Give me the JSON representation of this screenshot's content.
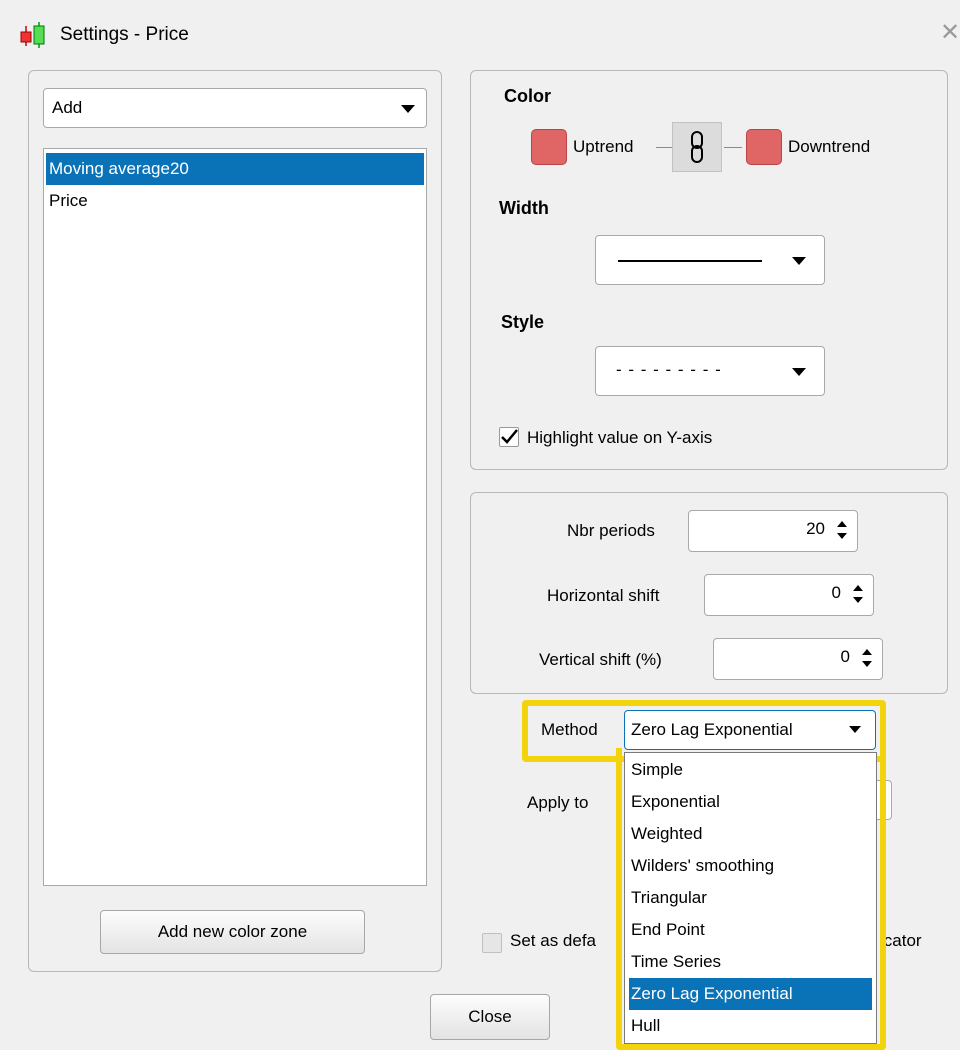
{
  "window": {
    "title": "Settings - Price",
    "app_icon": "candlestick-chart-icon",
    "close_icon": "close-icon"
  },
  "left": {
    "add_select": {
      "value": "Add"
    },
    "layers": [
      {
        "label": "Moving average20",
        "selected": true
      },
      {
        "label": "Price",
        "selected": false
      }
    ],
    "add_zone_button": "Add new color zone"
  },
  "appearance": {
    "color_label": "Color",
    "uptrend_label": "Uptrend",
    "downtrend_label": "Downtrend",
    "uptrend_color": "#e06666",
    "downtrend_color": "#e06666",
    "link_icon": "chain-link-icon",
    "width_label": "Width",
    "width_value": "solid-line",
    "style_label": "Style",
    "style_value": "- - - - - - - - -",
    "highlight_label": "Highlight value on Y-axis",
    "highlight_checked": true
  },
  "params": {
    "nbr_periods_label": "Nbr periods",
    "nbr_periods_value": "20",
    "horizontal_shift_label": "Horizontal shift",
    "horizontal_shift_value": "0",
    "vertical_shift_label": "Vertical shift (%)",
    "vertical_shift_value": "0"
  },
  "method": {
    "label": "Method",
    "value": "Zero Lag Exponential",
    "options": [
      "Simple",
      "Exponential",
      "Weighted",
      "Wilders' smoothing",
      "Triangular",
      "End Point",
      "Time Series",
      "Zero Lag Exponential",
      "Hull"
    ],
    "selected_index": 7
  },
  "apply_to_label": "Apply to",
  "default_left": "Set as defa",
  "default_right": "icator",
  "close_button": "Close",
  "colors": {
    "selection": "#0a73b8",
    "highlight": "#f3d30b",
    "background": "#f0f0f0"
  }
}
